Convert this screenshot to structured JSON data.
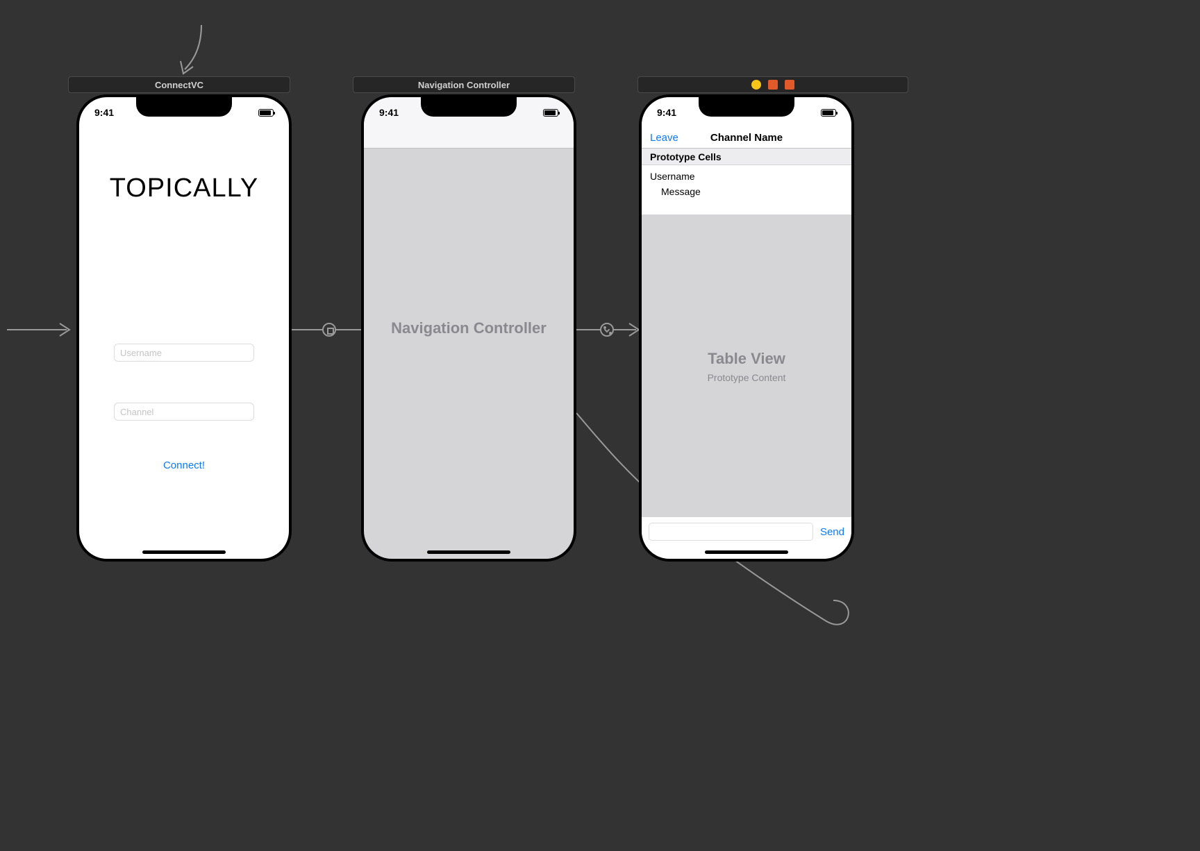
{
  "status_time": "9:41",
  "scenes": {
    "connect": {
      "bar_title": "ConnectVC",
      "app_title": "TOPICALLY",
      "username_placeholder": "Username",
      "channel_placeholder": "Channel",
      "connect_label": "Connect!"
    },
    "nav": {
      "bar_title": "Navigation Controller",
      "center_label": "Navigation Controller"
    },
    "channel": {
      "leave_label": "Leave",
      "nav_title": "Channel Name",
      "section_header": "Prototype Cells",
      "cell_username": "Username",
      "cell_message": "Message",
      "tableview_title": "Table View",
      "tableview_subtitle": "Prototype Content",
      "send_label": "Send"
    }
  }
}
